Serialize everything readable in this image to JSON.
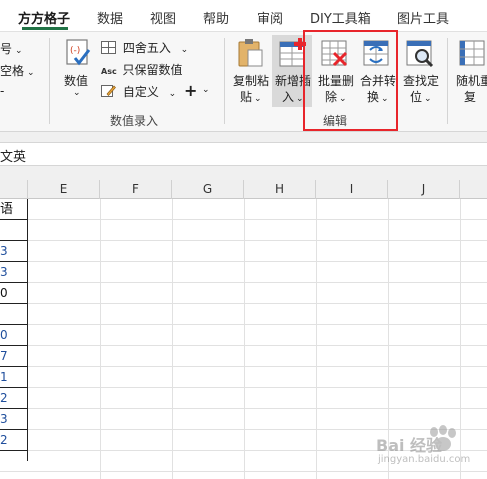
{
  "tabs": [
    {
      "label": "方方格子",
      "active": true
    },
    {
      "label": "数据",
      "active": false
    },
    {
      "label": "视图",
      "active": false
    },
    {
      "label": "帮助",
      "active": false
    },
    {
      "label": "审阅",
      "active": false
    },
    {
      "label": "DIY工具箱",
      "active": false
    },
    {
      "label": "图片工具",
      "active": false
    }
  ],
  "ribbon": {
    "left_partial": {
      "item1": "号",
      "item2": "空格",
      "item3": "-"
    },
    "value_group": {
      "value_button": "数值",
      "round_button": "四舍五入",
      "keep_value_button": "只保留数值",
      "custom_button": "自定义",
      "plus_label": "+",
      "group_label": "数值录入"
    },
    "copy_paste_button": {
      "line1": "复制粘",
      "line2": "贴"
    },
    "new_insert_button": {
      "line1": "新增插",
      "line2": "入"
    },
    "batch_delete_button": {
      "line1": "批量删",
      "line2": "除"
    },
    "merge_convert_button": {
      "line1": "合并转",
      "line2": "换"
    },
    "find_locate_button": {
      "line1": "查找定",
      "line2": "位"
    },
    "random_repeat_button": {
      "line1": "随机重",
      "line2": "复"
    },
    "edit_group_label": "编辑",
    "highlight_color": "#e8252b"
  },
  "formula_bar": {
    "content": "文英"
  },
  "columns": [
    "E",
    "F",
    "G",
    "H",
    "I",
    "J"
  ],
  "column_a_cells": [
    "语",
    "",
    "3",
    "3",
    "0",
    "",
    "0",
    "7",
    "1",
    "2",
    "3",
    "2"
  ],
  "accent_color": "#217346",
  "watermark": {
    "text": "Bai 经验",
    "subtext": "jingyan.baidu.com"
  }
}
